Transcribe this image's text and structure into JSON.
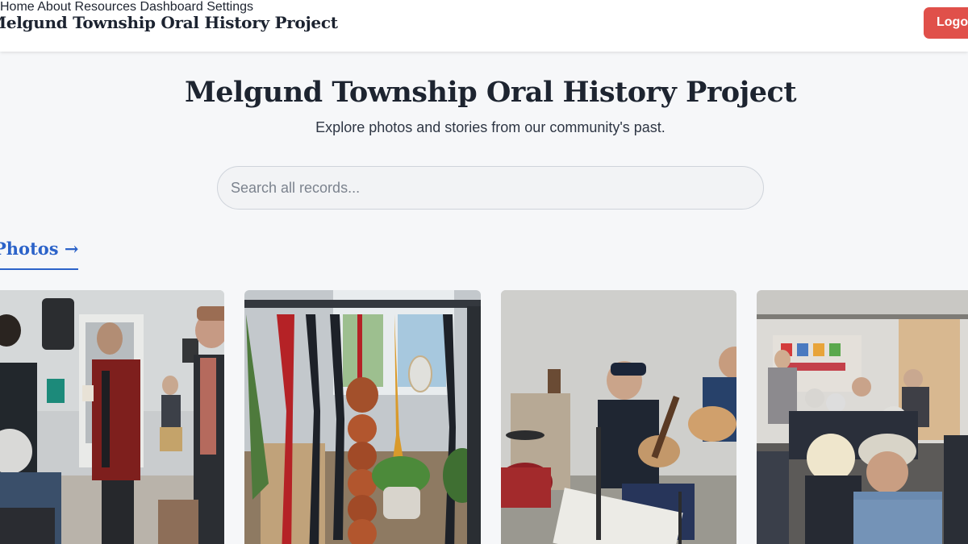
{
  "header": {
    "brand": "Melgund Township Oral History Project",
    "nav": [
      {
        "label": "Home"
      },
      {
        "label": "About"
      },
      {
        "label": "Resources"
      },
      {
        "label": "Dashboard"
      },
      {
        "label": "Settings"
      }
    ],
    "logout_label": "Logout"
  },
  "hero": {
    "title": "Melgund Township Oral History Project",
    "subtitle": "Explore photos and stories from our community's past."
  },
  "search": {
    "placeholder": "Search all records..."
  },
  "photos_section": {
    "link_label": "Photos →"
  },
  "colors": {
    "accent": "#2c63c9",
    "logout": "#e0504a",
    "background": "#f6f7f9"
  }
}
